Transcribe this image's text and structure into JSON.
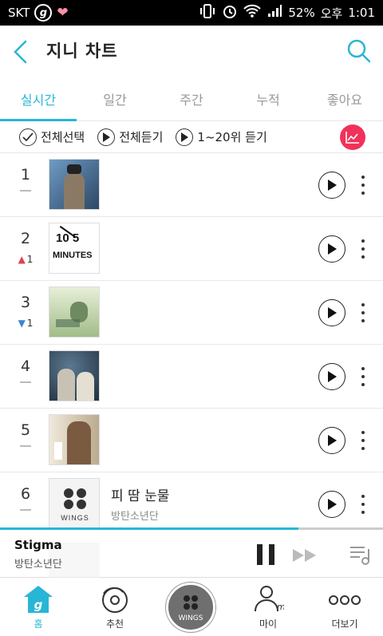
{
  "status_bar": {
    "carrier": "SKT",
    "battery": "52%",
    "ampm": "오후",
    "time": "1:01"
  },
  "header": {
    "title": "지니 차트"
  },
  "tabs": [
    {
      "label": "실시간",
      "active": true
    },
    {
      "label": "일간",
      "active": false
    },
    {
      "label": "주간",
      "active": false
    },
    {
      "label": "누적",
      "active": false
    },
    {
      "label": "좋아요",
      "active": false
    }
  ],
  "toolbar": {
    "select_all": "전체선택",
    "play_all": "전체듣기",
    "play_top20": "1~20위 듣기"
  },
  "chart": {
    "rows": [
      {
        "rank": "1",
        "change": "",
        "song": "",
        "artist": "",
        "art_color": "#3b5f86"
      },
      {
        "rank": "2",
        "change": "1",
        "direction": "up",
        "song": "",
        "artist": "",
        "art_color": "#ffffff"
      },
      {
        "rank": "3",
        "change": "1",
        "direction": "down",
        "song": "",
        "artist": "",
        "art_color": "#c9d9b0"
      },
      {
        "rank": "4",
        "change": "",
        "song": "",
        "artist": "",
        "art_color": "#2f4457"
      },
      {
        "rank": "5",
        "change": "",
        "song": "",
        "artist": "",
        "art_color": "#d8cdb8"
      },
      {
        "rank": "6",
        "change": "",
        "song": "피 땀 눈물",
        "artist": "방탄소년단",
        "art_color": "#f4f4f4"
      }
    ]
  },
  "player": {
    "title": "Stigma",
    "artist": "방탄소년단",
    "progress": 0.78
  },
  "nav": {
    "home": "홈",
    "recommend": "추천",
    "center": "WINGS",
    "my": "마이",
    "more": "더보기"
  },
  "colors": {
    "accent": "#29b6d6",
    "red": "#f0325a"
  }
}
